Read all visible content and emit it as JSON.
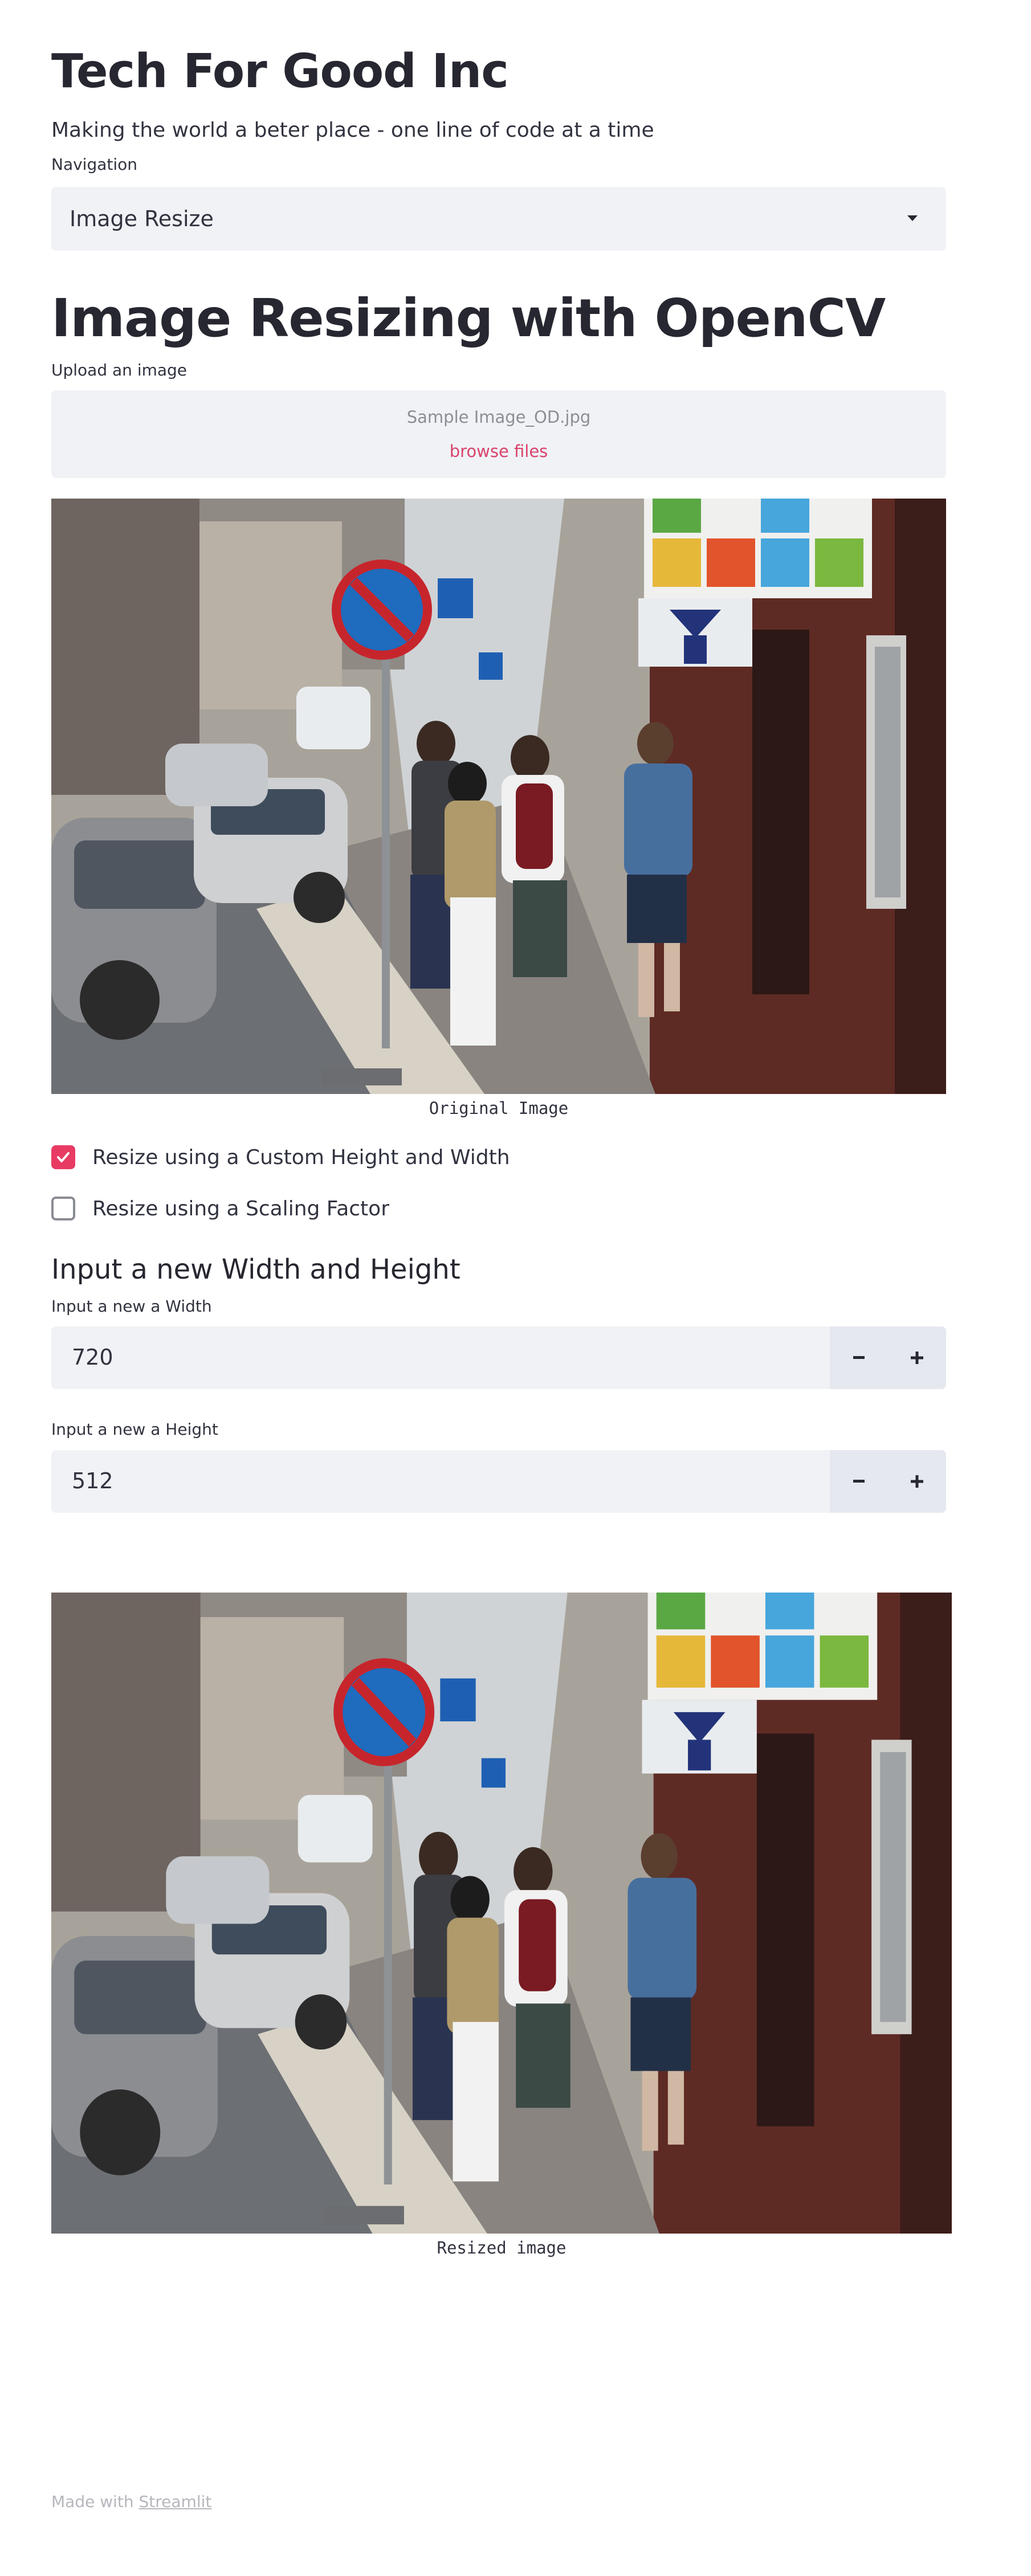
{
  "app": {
    "title": "Tech For Good Inc",
    "subtitle": "Making the world a beter place - one line of code at a time"
  },
  "navigation": {
    "label": "Navigation",
    "selected": "Image Resize"
  },
  "section": {
    "title": "Image Resizing with OpenCV"
  },
  "uploader": {
    "label": "Upload an image",
    "filename": "Sample Image_OD.jpg",
    "browse_label": "browse files"
  },
  "original_image": {
    "caption": "Original Image"
  },
  "options": {
    "custom_label": "Resize using a Custom Height and Width",
    "custom_checked": true,
    "scaling_label": "Resize using a Scaling Factor",
    "scaling_checked": false
  },
  "resize_form": {
    "heading": "Input a new Width and Height",
    "width_label": "Input a new a Width",
    "width_value": "720",
    "height_label": "Input a new a Height",
    "height_value": "512"
  },
  "resized_image": {
    "caption": "Resized image"
  },
  "footer": {
    "prefix": "Made with",
    "link_text": "Streamlit"
  },
  "colors": {
    "accent": "#e83b63",
    "input_bg": "#f0f2f6",
    "text": "#262730"
  }
}
